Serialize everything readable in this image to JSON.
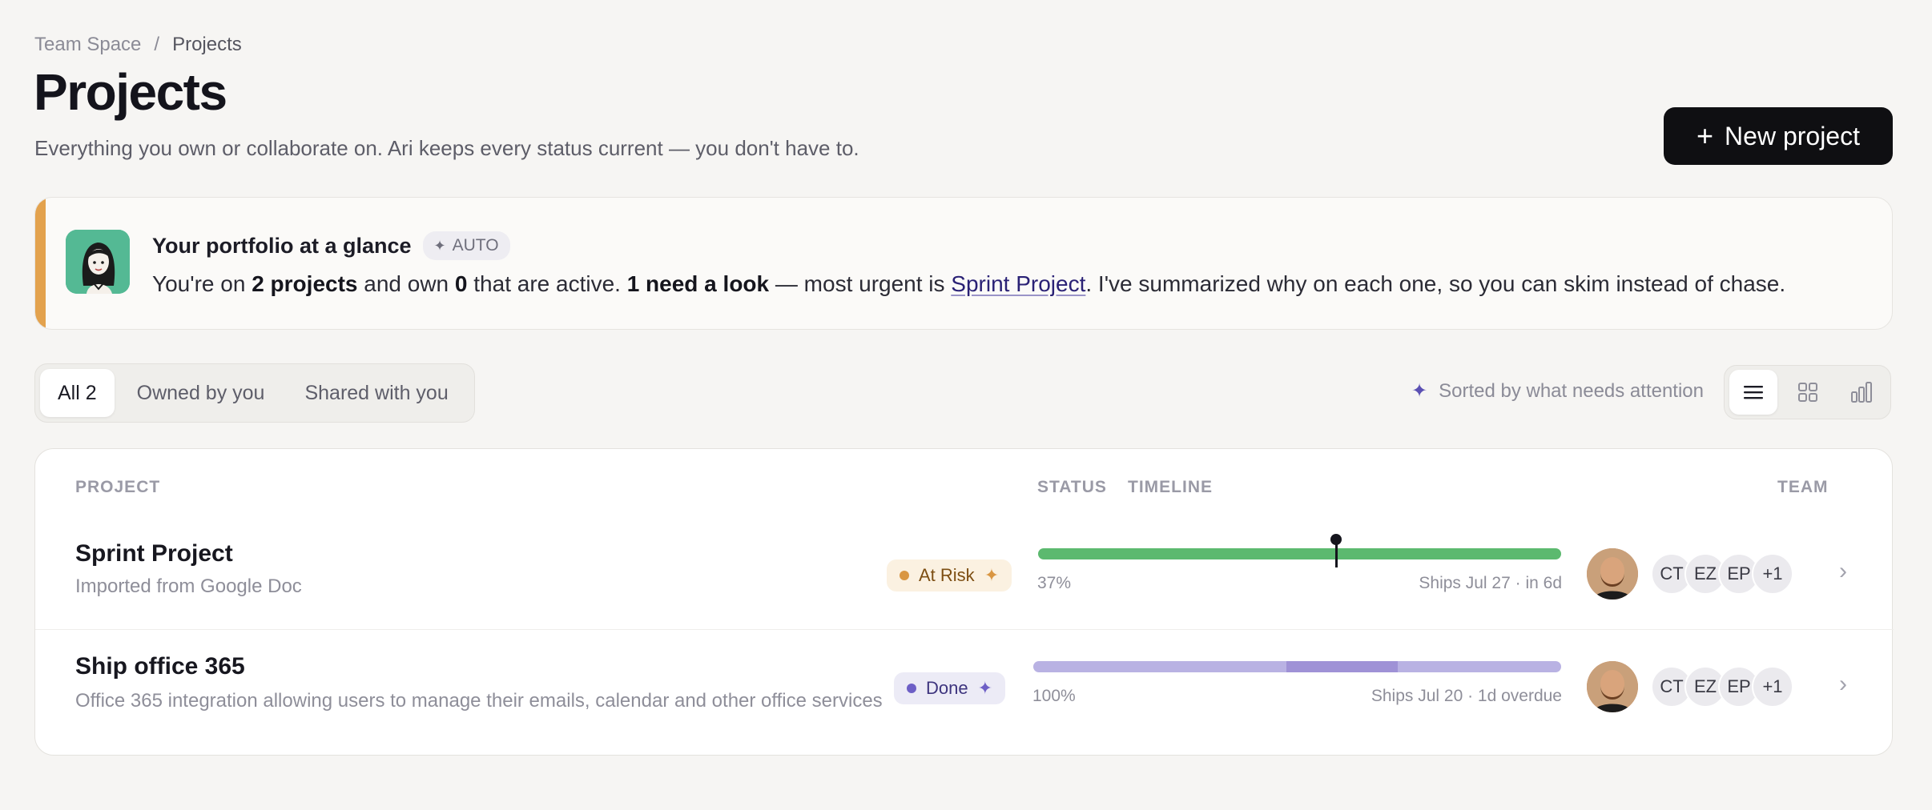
{
  "breadcrumb": {
    "root": "Team Space",
    "separator": "/",
    "current": "Projects"
  },
  "page": {
    "title": "Projects",
    "subtitle": "Everything you own or collaborate on. Ari keeps every status current — you don't have to.",
    "new_button": "New project"
  },
  "summary": {
    "title": "Your portfolio at a glance",
    "badge": "AUTO",
    "text_1": "You're on ",
    "projects_count": "2 projects",
    "text_2": " and own ",
    "owned_count": "0",
    "text_3": " that are active. ",
    "need_look": "1 need a look",
    "text_4": " — most urgent is ",
    "urgent_link": "Sprint Project",
    "text_5": ". I've summarized why on each one, so you can skim instead of chase."
  },
  "filters": [
    {
      "label": "All 2",
      "active": true
    },
    {
      "label": "Owned by you",
      "active": false
    },
    {
      "label": "Shared with you",
      "active": false
    }
  ],
  "sort_note": "Sorted by what needs attention",
  "view_icons": [
    "list-view-icon",
    "grid-view-icon",
    "chart-view-icon"
  ],
  "table": {
    "headers": {
      "project": "PROJECT",
      "status": "STATUS",
      "timeline": "TIMELINE",
      "team": "TEAM"
    },
    "rows": [
      {
        "name": "Sprint Project",
        "description": "Imported from Google Doc",
        "status": "At Risk",
        "progress": 0.37,
        "progress_label": "37%",
        "ships": "Ships Jul 27 · in 6d",
        "today_marker": 0.57,
        "bar_color": "#5cb96f",
        "initials": [
          "CT",
          "EZ",
          "EP",
          "+1"
        ]
      },
      {
        "name": "Ship office 365",
        "description": "Office 365 integration allowing users to manage their emails, calendar and other office services",
        "status": "Done",
        "progress": 1.0,
        "progress_label": "100%",
        "ships": "Ships Jul 20 · 1d overdue",
        "bar_color": "#b9b2e3",
        "overdue_band": [
          0.48,
          0.69
        ],
        "initials": [
          "CT",
          "EZ",
          "EP",
          "+1"
        ]
      }
    ]
  },
  "colors": {
    "accent": "#e3a24d",
    "primary_button": "#0f0f12",
    "sparkle": "#5b50b3"
  }
}
